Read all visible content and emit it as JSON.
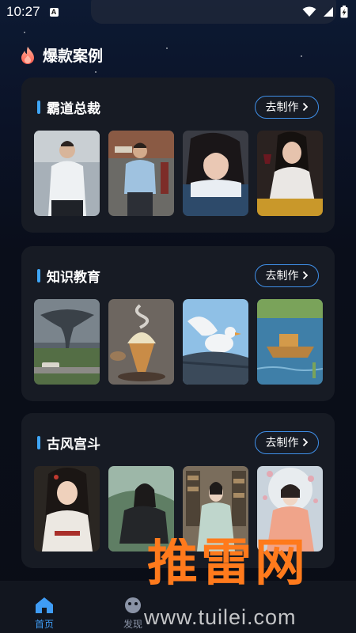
{
  "status_bar": {
    "time": "10:27",
    "notification_letter": "A"
  },
  "header": {
    "title": "爆款案例"
  },
  "cards": [
    {
      "title": "霸道总裁",
      "button_label": "去制作",
      "thumbs": [
        "man-office-photo",
        "man-street-photo",
        "woman-lying-photo",
        "woman-wine-photo"
      ]
    },
    {
      "title": "知识教育",
      "button_label": "去制作",
      "thumbs": [
        "tornado-photo",
        "ice-cream-photo",
        "dove-photo",
        "boat-photo"
      ]
    },
    {
      "title": "古风宫斗",
      "button_label": "去制作",
      "thumbs": [
        "hanfu-girl-photo",
        "ancient-man-photo",
        "library-lady-photo",
        "flower-lady-photo"
      ]
    }
  ],
  "tabbar": {
    "tabs": [
      {
        "label": "首页",
        "icon": "home-icon",
        "active": true
      },
      {
        "label": "发现",
        "icon": "discover-icon",
        "active": false
      }
    ]
  },
  "watermark": {
    "main": "推雷网",
    "url": "www.tuilei.com"
  },
  "colors": {
    "accent": "#3fa6f6",
    "button_border": "#3f8fe8",
    "card_bg": "#171b24",
    "watermark": "#ff7a1c"
  }
}
